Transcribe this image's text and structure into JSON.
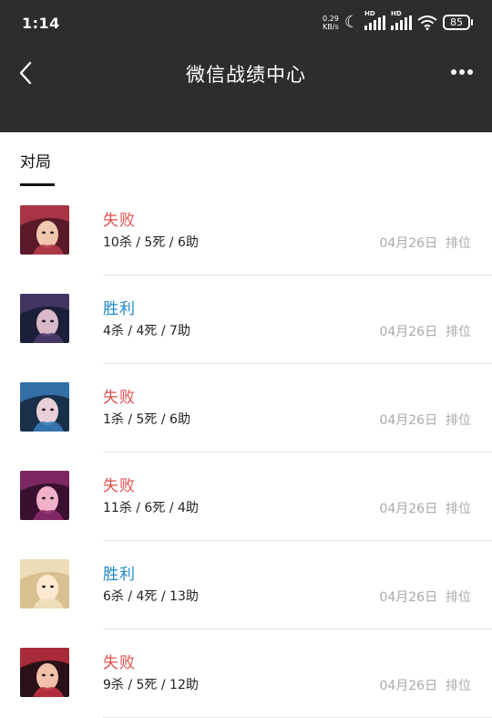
{
  "status_bar": {
    "time": "1:14",
    "net_speed_value": "0.29",
    "net_speed_unit": "KB/s",
    "signal1_label": "HD",
    "signal2_label": "HD",
    "battery": "85"
  },
  "header": {
    "title": "微信战绩中心"
  },
  "tabs": [
    {
      "label": "对局",
      "active": true
    }
  ],
  "matches": [
    {
      "result": "失败",
      "outcome": "lose",
      "kda": "10杀 / 5死 / 6助",
      "date": "04月26日",
      "mode": "排位",
      "avatar_palette": [
        "#5a1a2a",
        "#b63a4a",
        "#f0c8b0"
      ]
    },
    {
      "result": "胜利",
      "outcome": "win",
      "kda": "4杀 / 4死 / 7助",
      "date": "04月26日",
      "mode": "排位",
      "avatar_palette": [
        "#1b1f3a",
        "#4a3a6a",
        "#d9b8c8"
      ]
    },
    {
      "result": "失败",
      "outcome": "lose",
      "kda": "1杀 / 5死 / 6助",
      "date": "04月26日",
      "mode": "排位",
      "avatar_palette": [
        "#18304a",
        "#3a7ab8",
        "#e8d0d8"
      ]
    },
    {
      "result": "失败",
      "outcome": "lose",
      "kda": "11杀 / 6死 / 4助",
      "date": "04月26日",
      "mode": "排位",
      "avatar_palette": [
        "#3a1030",
        "#8a2a6a",
        "#f2b0c8"
      ]
    },
    {
      "result": "胜利",
      "outcome": "win",
      "kda": "6杀 / 4死 / 13助",
      "date": "04月26日",
      "mode": "排位",
      "avatar_palette": [
        "#d8c090",
        "#f0e0c0",
        "#ffe8d0"
      ]
    },
    {
      "result": "失败",
      "outcome": "lose",
      "kda": "9杀 / 5死 / 12助",
      "date": "04月26日",
      "mode": "排位",
      "avatar_palette": [
        "#2a1018",
        "#c03040",
        "#f0c0a8"
      ]
    }
  ],
  "colors": {
    "header_bg": "#2d2d2d",
    "lose": "#e0504e",
    "win": "#1e88c8",
    "meta": "#aaaaaa"
  }
}
